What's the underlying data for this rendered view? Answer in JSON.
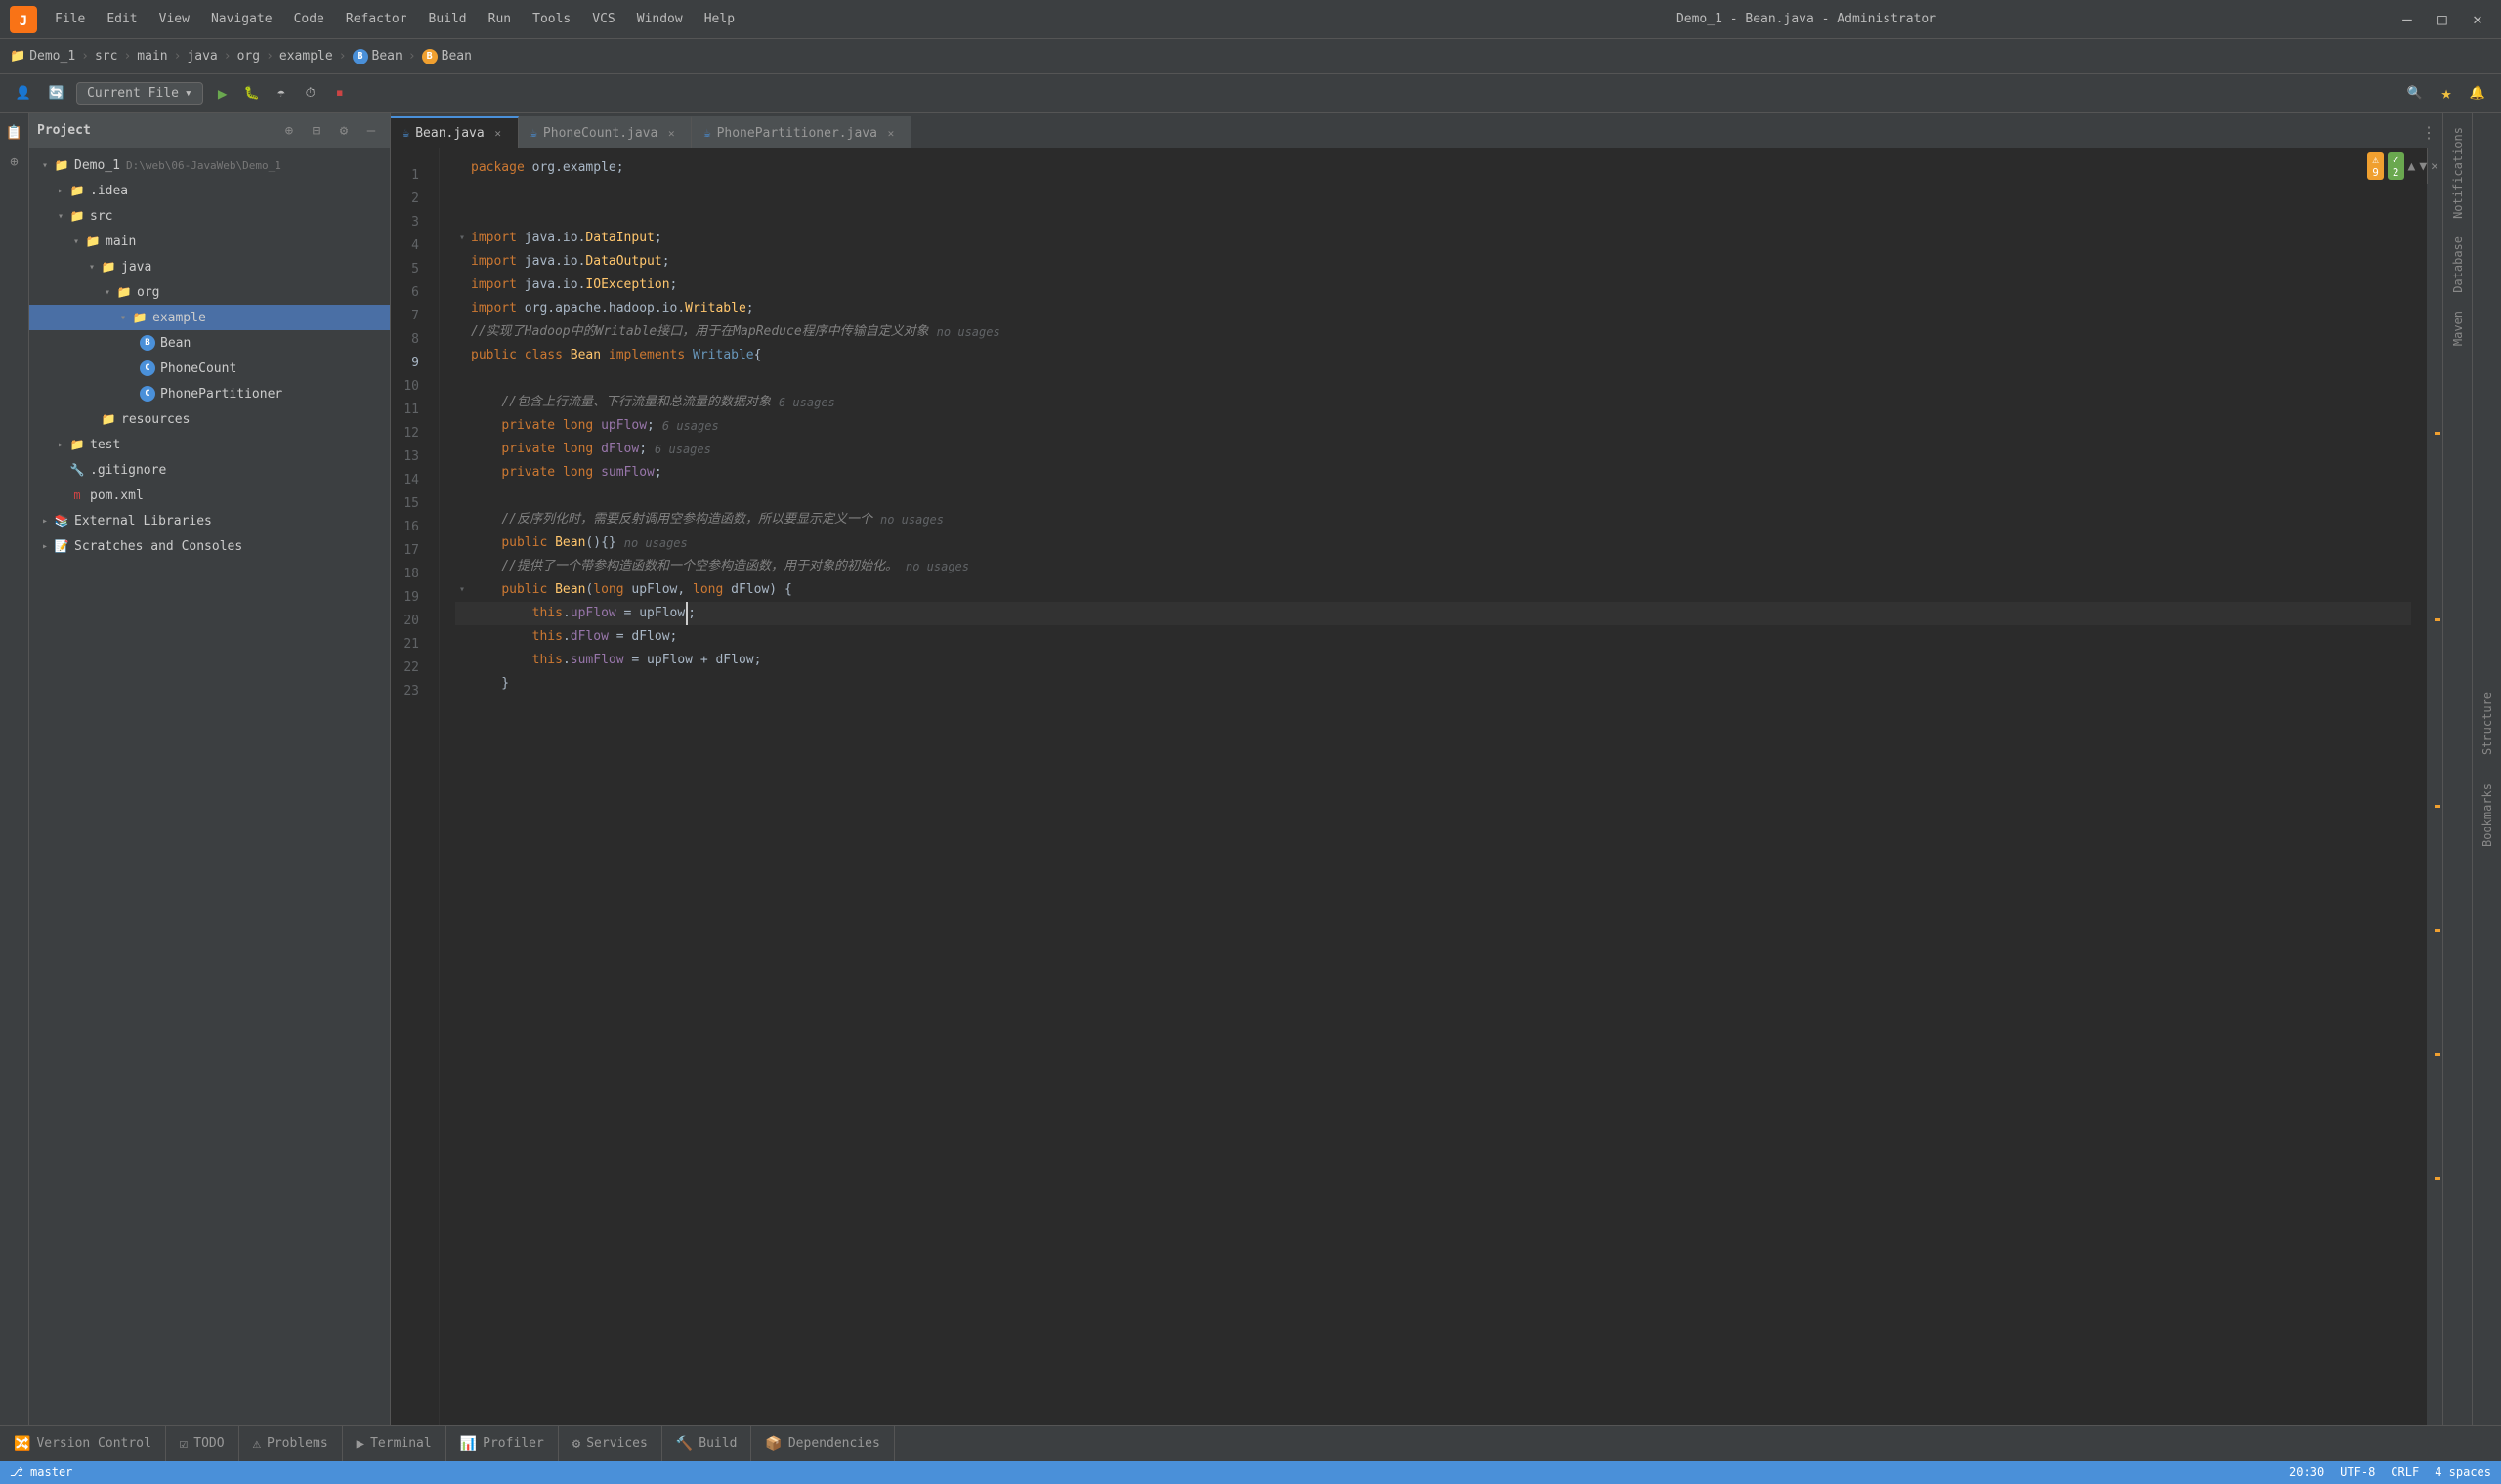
{
  "titlebar": {
    "title": "Demo_1 - Bean.java - Administrator",
    "app_icon": "intellij",
    "menus": [
      "File",
      "Edit",
      "View",
      "Navigate",
      "Code",
      "Refactor",
      "Build",
      "Run",
      "Tools",
      "VCS",
      "Window",
      "Help"
    ]
  },
  "breadcrumb": {
    "items": [
      "Demo_1",
      "src",
      "main",
      "java",
      "org",
      "example",
      "Bean",
      "Bean"
    ]
  },
  "toolbar": {
    "run_config": "Current File",
    "run_config_dropdown": "▾"
  },
  "tabs": [
    {
      "label": "Bean.java",
      "active": true,
      "icon": "java"
    },
    {
      "label": "PhoneCount.java",
      "active": false,
      "icon": "java"
    },
    {
      "label": "PhonePartitioner.java",
      "active": false,
      "icon": "java"
    }
  ],
  "project_panel": {
    "title": "Project",
    "root": {
      "name": "Demo_1",
      "path": "D:\\web\\06-JavaWeb\\Demo_1",
      "children": [
        {
          "name": ".idea",
          "type": "folder",
          "indent": 1
        },
        {
          "name": "src",
          "type": "folder",
          "indent": 1,
          "children": [
            {
              "name": "main",
              "type": "folder",
              "indent": 2,
              "children": [
                {
                  "name": "java",
                  "type": "folder",
                  "indent": 3,
                  "children": [
                    {
                      "name": "org",
                      "type": "folder",
                      "indent": 4,
                      "children": [
                        {
                          "name": "example",
                          "type": "folder",
                          "indent": 5,
                          "selected": true,
                          "children": [
                            {
                              "name": "Bean",
                              "type": "class-bean",
                              "indent": 6
                            },
                            {
                              "name": "PhoneCount",
                              "type": "class",
                              "indent": 6
                            },
                            {
                              "name": "PhonePartitioner",
                              "type": "class",
                              "indent": 6
                            }
                          ]
                        }
                      ]
                    }
                  ]
                }
              ]
            },
            {
              "name": "resources",
              "type": "folder-res",
              "indent": 2
            }
          ]
        },
        {
          "name": "test",
          "type": "folder",
          "indent": 1
        },
        {
          "name": ".gitignore",
          "type": "gitignore",
          "indent": 1
        },
        {
          "name": "pom.xml",
          "type": "maven",
          "indent": 1
        }
      ]
    },
    "external": "External Libraries",
    "scratches": "Scratches and Consoles"
  },
  "editor": {
    "filename": "Bean.java",
    "lines": [
      {
        "num": 1,
        "content": "package org.example;",
        "type": "package"
      },
      {
        "num": 2,
        "content": "",
        "type": "blank"
      },
      {
        "num": 3,
        "content": "",
        "type": "blank"
      },
      {
        "num": 4,
        "content": "import java.io.DataInput;",
        "type": "import",
        "fold": true
      },
      {
        "num": 5,
        "content": "import java.io.DataOutput;",
        "type": "import"
      },
      {
        "num": 6,
        "content": "import java.io.IOException;",
        "type": "import"
      },
      {
        "num": 7,
        "content": "import org.apache.hadoop.io.Writable;",
        "type": "import"
      },
      {
        "num": 8,
        "content": "//实现了Hadoop中的Writable接口，用于在MapReduce程序中传输自定义对象",
        "type": "comment",
        "hint": "no usages"
      },
      {
        "num": 9,
        "content": "public class Bean implements Writable{",
        "type": "class"
      },
      {
        "num": 10,
        "content": "",
        "type": "blank"
      },
      {
        "num": 11,
        "content": "    //包含上行流量、下行流量和总流量的数据对象",
        "type": "comment",
        "hint": "6 usages"
      },
      {
        "num": 12,
        "content": "    private long upFlow;",
        "type": "field",
        "hint": "6 usages"
      },
      {
        "num": 13,
        "content": "    private long dFlow;",
        "type": "field",
        "hint": "6 usages"
      },
      {
        "num": 14,
        "content": "    private long sumFlow;",
        "type": "field"
      },
      {
        "num": 15,
        "content": "",
        "type": "blank"
      },
      {
        "num": 16,
        "content": "    //反序列化时，需要反射调用空参构造函数，所以要显示定义一个",
        "type": "comment",
        "hint": "no usages"
      },
      {
        "num": 17,
        "content": "    public Bean(){}",
        "type": "method",
        "hint": "no usages"
      },
      {
        "num": 18,
        "content": "    //提供了一个带参构造函数和一个空参构造函数，用于对象的初始化。",
        "type": "comment",
        "hint": "no usages"
      },
      {
        "num": 19,
        "content": "    public Bean(long upFlow, long dFlow) {",
        "type": "method",
        "fold": true
      },
      {
        "num": 20,
        "content": "        this.upFlow = upFlow;",
        "type": "code",
        "cursor": true
      },
      {
        "num": 21,
        "content": "        this.dFlow = dFlow;",
        "type": "code"
      },
      {
        "num": 22,
        "content": "        this.sumFlow = upFlow + dFlow;",
        "type": "code"
      },
      {
        "num": 23,
        "content": "    }",
        "type": "code"
      }
    ],
    "warnings": 9,
    "ok": 2
  },
  "bottom_tabs": [
    {
      "label": "Version Control",
      "icon": "vcs"
    },
    {
      "label": "TODO",
      "icon": "todo"
    },
    {
      "label": "Problems",
      "icon": "problems"
    },
    {
      "label": "Terminal",
      "icon": "terminal"
    },
    {
      "label": "Profiler",
      "icon": "profiler"
    },
    {
      "label": "Services",
      "icon": "services"
    },
    {
      "label": "Build",
      "icon": "build"
    },
    {
      "label": "Dependencies",
      "icon": "dependencies"
    }
  ],
  "status_bar": {
    "time": "20:30",
    "encoding": "UTF-8",
    "line_ending": "CRLF",
    "indent": "4 spaces",
    "position": ""
  },
  "right_panels": [
    "Notifications",
    "Database",
    "Maven"
  ],
  "structure_label": "Structure",
  "bookmarks_label": "Bookmarks"
}
